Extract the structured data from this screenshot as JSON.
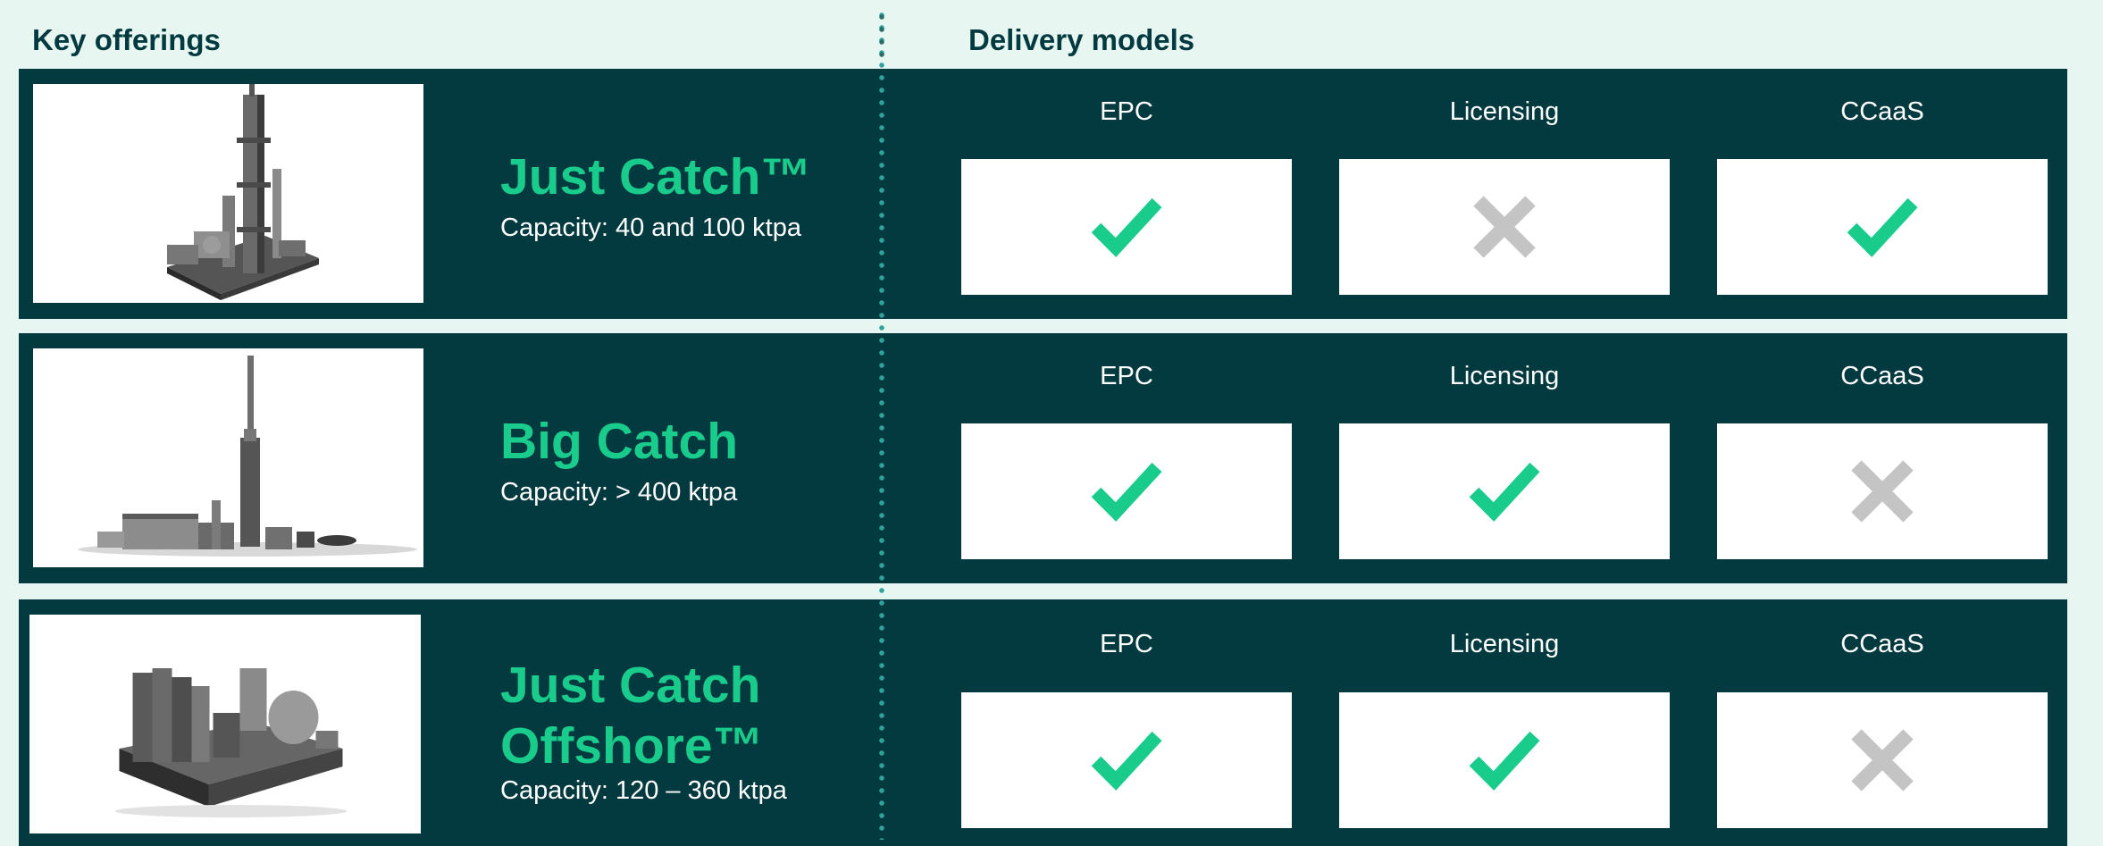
{
  "headers": {
    "key_offerings": "Key offerings",
    "delivery_models": "Delivery models"
  },
  "colors": {
    "background": "#e8f6f2",
    "panel": "#033a40",
    "accent_green": "#19cc8c",
    "cross_gray": "#c4c4c4",
    "divider": "#2fa39b"
  },
  "offerings": [
    {
      "name": "Just Catch™",
      "capacity": "Capacity: 40 and 100 ktpa",
      "image_icon": "tower-plant-image",
      "models": [
        {
          "label": "EPC",
          "available": true,
          "icon": "check-icon"
        },
        {
          "label": "Licensing",
          "available": false,
          "icon": "cross-icon"
        },
        {
          "label": "CCaaS",
          "available": true,
          "icon": "check-icon"
        }
      ]
    },
    {
      "name": "Big Catch",
      "capacity": "Capacity: > 400 ktpa",
      "image_icon": "large-plant-image",
      "models": [
        {
          "label": "EPC",
          "available": true,
          "icon": "check-icon"
        },
        {
          "label": "Licensing",
          "available": true,
          "icon": "check-icon"
        },
        {
          "label": "CCaaS",
          "available": false,
          "icon": "cross-icon"
        }
      ]
    },
    {
      "name": "Just Catch\nOffshore™",
      "capacity": "Capacity: 120 – 360 ktpa",
      "image_icon": "offshore-module-image",
      "models": [
        {
          "label": "EPC",
          "available": true,
          "icon": "check-icon"
        },
        {
          "label": "Licensing",
          "available": true,
          "icon": "check-icon"
        },
        {
          "label": "CCaaS",
          "available": false,
          "icon": "cross-icon"
        }
      ]
    }
  ]
}
